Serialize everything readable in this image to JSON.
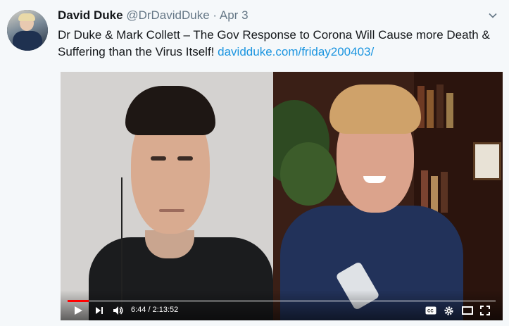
{
  "tweet": {
    "author_name": "David Duke",
    "handle": "@DrDavidDuke",
    "separator": "·",
    "date": "Apr 3",
    "text": "Dr Duke & Mark Collett – The Gov Response to Corona Will Cause more Death & Suffering than the Virus Itself!",
    "link_text": "davidduke.com/friday200403/"
  },
  "video": {
    "current_time": "6:44",
    "duration": "2:13:52",
    "time_display": "6:44 / 2:13:52",
    "progress_fraction": 0.05,
    "progress_color": "#ff0000"
  },
  "icons": {
    "caret": "chevron-down-icon",
    "play": "play-icon",
    "next": "next-icon",
    "volume": "volume-icon",
    "captions": "captions-icon",
    "settings": "gear-icon",
    "theater": "theater-mode-icon",
    "fullscreen": "fullscreen-icon"
  },
  "colors": {
    "link": "#1b95e0",
    "name": "#14171a",
    "meta": "#657786",
    "background": "#f5f8fa"
  }
}
